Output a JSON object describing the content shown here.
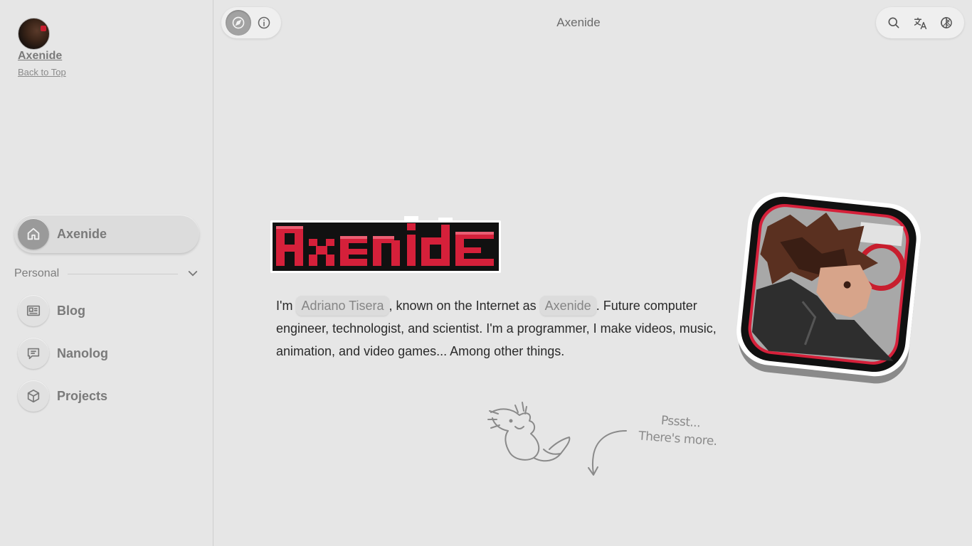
{
  "sidebar": {
    "profile_name": "Axenide",
    "back_to_top": "Back to Top",
    "home_label": "Axenide",
    "section_title": "Personal",
    "items": [
      {
        "label": "Blog",
        "icon": "blog-icon"
      },
      {
        "label": "Nanolog",
        "icon": "message-icon"
      },
      {
        "label": "Projects",
        "icon": "box-icon"
      }
    ]
  },
  "topbar": {
    "title": "Axenide",
    "left_icons": [
      "compass-icon",
      "info-icon"
    ],
    "right_icons": [
      "search-icon",
      "translate-icon",
      "theme-icon"
    ]
  },
  "main": {
    "logo_text": "Axenide",
    "intro_before": "I'm ",
    "name_chip": "Adriano Tisera",
    "intro_middle": ", known on the Internet as ",
    "alias_chip": "Axenide",
    "intro_after": ". Future computer engineer, technologist, and scientist. I'm a programmer, I make videos, music, animation, and video games... Among other things.",
    "hint_line1": "Pssst...",
    "hint_line2": "There's more."
  },
  "colors": {
    "accent": "#d5203a",
    "background": "#e6e6e6",
    "muted_text": "#7a7a7a"
  }
}
